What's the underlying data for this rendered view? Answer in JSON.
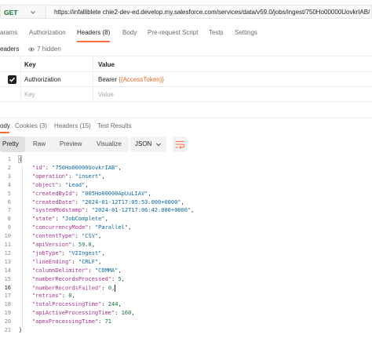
{
  "request": {
    "method": "GET",
    "url": "https://infalliblete chie2-dev-ed.develop.my.salesforce.com/services/data/v59.0/jobs/ingest/750Ho00000UovkrIAB/"
  },
  "request_tabs": [
    {
      "label": "arams"
    },
    {
      "label": "Authorization"
    },
    {
      "label": "Headers (8)"
    },
    {
      "label": "Body"
    },
    {
      "label": "Pre-request Script"
    },
    {
      "label": "Tests"
    },
    {
      "label": "Settings"
    }
  ],
  "headers_sub": {
    "label": "eaders",
    "hidden": "7 hidden"
  },
  "headers_table": {
    "col_key": "Key",
    "col_value": "Value",
    "row": {
      "key": "Authorization",
      "value_prefix": "Bearer ",
      "value_var": "{{AccessToken}}",
      "checked": true
    },
    "new_row": {
      "key_placeholder": "Key",
      "value_placeholder": "Value"
    }
  },
  "response_tabs": [
    {
      "label": "ody"
    },
    {
      "label": "Cookies (3)"
    },
    {
      "label": "Headers (15)"
    },
    {
      "label": "Test Results"
    }
  ],
  "view_modes": [
    {
      "label": "Pretty"
    },
    {
      "label": "Raw"
    },
    {
      "label": "Preview"
    },
    {
      "label": "Visualize"
    }
  ],
  "format_select": "JSON",
  "colors": {
    "accent": "#ff6c37",
    "method": "#117233",
    "json_key": "#a7328c",
    "json_string": "#0c6a9e",
    "json_number": "#117233"
  },
  "code": {
    "line_numbers": [
      "1",
      "2",
      "3",
      "4",
      "5",
      "6",
      "7",
      "8",
      "9",
      "10",
      "11",
      "12",
      "13",
      "14",
      "15",
      "16",
      "17",
      "18",
      "19",
      "20",
      "21"
    ],
    "current_line": "16",
    "lines": [
      {
        "p": "{"
      },
      {
        "k": "\"id\"",
        "v": "\"750Ho00000UovkrIAB\"",
        "t": "str",
        "c": ","
      },
      {
        "k": "\"operation\"",
        "v": "\"insert\"",
        "t": "str",
        "c": ","
      },
      {
        "k": "\"object\"",
        "v": "\"Lead\"",
        "t": "str",
        "c": ","
      },
      {
        "k": "\"createdById\"",
        "v": "\"005Ho00000ApUuLIAV\"",
        "t": "str",
        "c": ","
      },
      {
        "k": "\"createdDate\"",
        "v": "\"2024-01-12T17:05:53.000+0000\"",
        "t": "str",
        "c": ","
      },
      {
        "k": "\"systemModstamp\"",
        "v": "\"2024-01-12T17:06:42.000+0000\"",
        "t": "str",
        "c": ","
      },
      {
        "k": "\"state\"",
        "v": "\"JobComplete\"",
        "t": "str",
        "c": ","
      },
      {
        "k": "\"concurrencyMode\"",
        "v": "\"Parallel\"",
        "t": "str",
        "c": ","
      },
      {
        "k": "\"contentType\"",
        "v": "\"CSV\"",
        "t": "str",
        "c": ","
      },
      {
        "k": "\"apiVersion\"",
        "v": "59.0",
        "t": "num",
        "c": ","
      },
      {
        "k": "\"jobType\"",
        "v": "\"V2Ingest\"",
        "t": "str",
        "c": ","
      },
      {
        "k": "\"lineEnding\"",
        "v": "\"CRLF\"",
        "t": "str",
        "c": ","
      },
      {
        "k": "\"columnDelimiter\"",
        "v": "\"COMMA\"",
        "t": "str",
        "c": ","
      },
      {
        "k": "\"numberRecordsProcessed\"",
        "v": "5",
        "t": "num",
        "c": ","
      },
      {
        "k": "\"numberRecordsFailed\"",
        "v": "0",
        "t": "num",
        "c": ","
      },
      {
        "k": "\"retries\"",
        "v": "0",
        "t": "num",
        "c": ","
      },
      {
        "k": "\"totalProcessingTime\"",
        "v": "244",
        "t": "num",
        "c": ","
      },
      {
        "k": "\"apiActiveProcessingTime\"",
        "v": "160",
        "t": "num",
        "c": ","
      },
      {
        "k": "\"apexProcessingTime\"",
        "v": "71",
        "t": "num",
        "c": ""
      },
      {
        "p": "}"
      }
    ]
  }
}
